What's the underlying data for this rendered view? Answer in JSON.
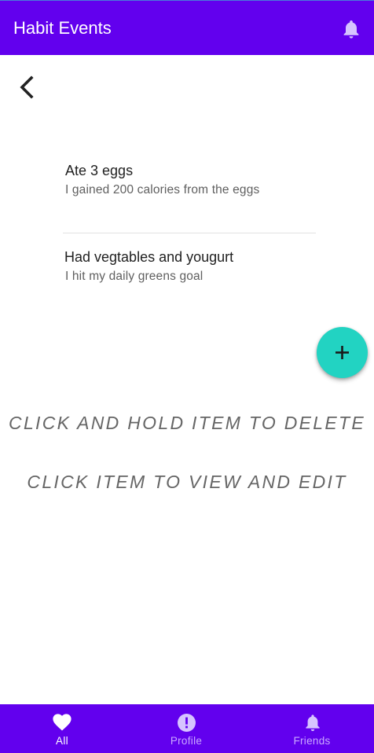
{
  "app_bar": {
    "title": "Habit Events",
    "notification_icon": "bell-icon"
  },
  "back_icon": "chevron-left-icon",
  "events": [
    {
      "title": "Ate 3 eggs",
      "description": "I gained 200 calories from the eggs"
    },
    {
      "title": "Had vegtables and yougurt",
      "description": "I hit my daily greens goal"
    }
  ],
  "fab": {
    "icon": "plus-icon"
  },
  "hints": {
    "delete": "CLICK AND HOLD ITEM TO DELETE",
    "edit": "CLICK ITEM TO VIEW AND EDIT"
  },
  "bottom_nav": {
    "items": [
      {
        "label": "All",
        "icon": "heart-icon",
        "active": true
      },
      {
        "label": "Profile",
        "icon": "alert-circle-icon",
        "active": false
      },
      {
        "label": "Friends",
        "icon": "bell-icon",
        "active": false
      }
    ]
  },
  "colors": {
    "primary": "#6200ee",
    "fab": "#22d3c2",
    "nav_inactive": "#c9a8ff",
    "hint_text": "#666666"
  }
}
